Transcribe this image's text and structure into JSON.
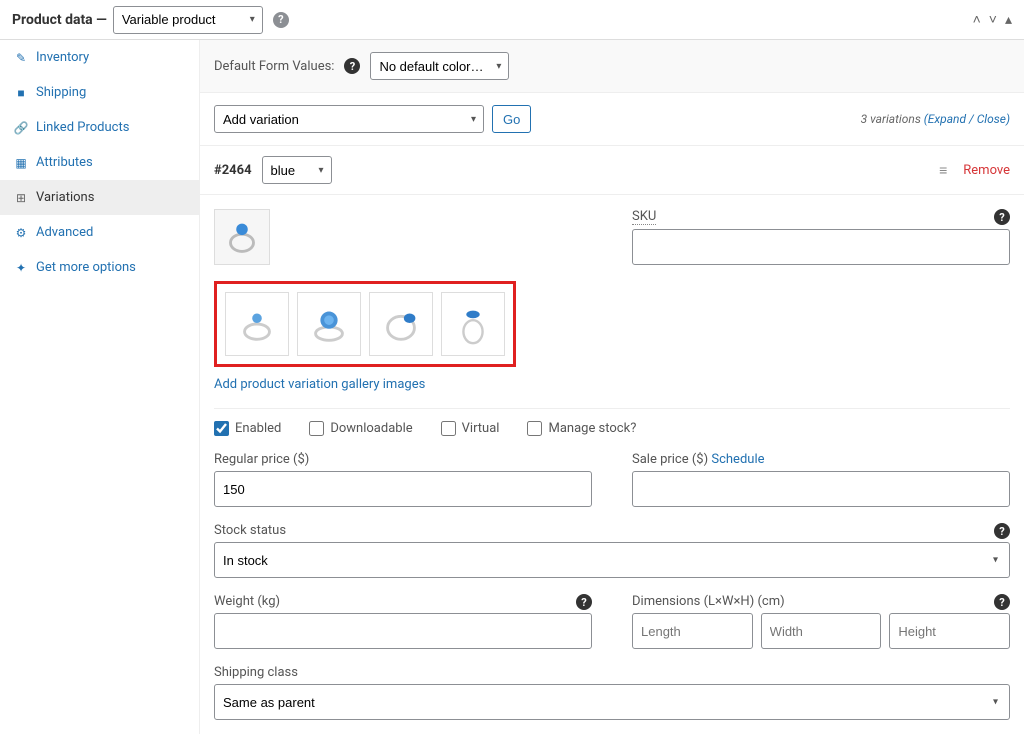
{
  "header": {
    "title_prefix": "Product data —",
    "product_type": "Variable product"
  },
  "sidebar": {
    "items": [
      {
        "label": "Inventory"
      },
      {
        "label": "Shipping"
      },
      {
        "label": "Linked Products"
      },
      {
        "label": "Attributes"
      },
      {
        "label": "Variations"
      },
      {
        "label": "Advanced"
      },
      {
        "label": "Get more options"
      }
    ]
  },
  "form": {
    "default_values_label": "Default Form Values:",
    "default_color": "No default color…",
    "add_variation": "Add variation",
    "go_btn": "Go",
    "variations_count_text": "3 variations ",
    "expand_close": "(Expand / Close)"
  },
  "variation": {
    "id": "#2464",
    "color": "blue",
    "remove": "Remove",
    "sku_label": "SKU",
    "sku_value": "",
    "gallery_link": "Add product variation gallery images",
    "checks": {
      "enabled": "Enabled",
      "downloadable": "Downloadable",
      "virtual": "Virtual",
      "manage_stock": "Manage stock?"
    },
    "regular_price_label": "Regular price ($)",
    "regular_price_value": "150",
    "sale_price_label": "Sale price ($) ",
    "schedule": "Schedule",
    "sale_price_value": "",
    "stock_status_label": "Stock status",
    "stock_status_value": "In stock",
    "weight_label": "Weight (kg)",
    "weight_value": "",
    "dims_label": "Dimensions (L×W×H) (cm)",
    "dim_l_ph": "Length",
    "dim_w_ph": "Width",
    "dim_h_ph": "Height",
    "shipping_class_label": "Shipping class",
    "shipping_class_value": "Same as parent"
  }
}
